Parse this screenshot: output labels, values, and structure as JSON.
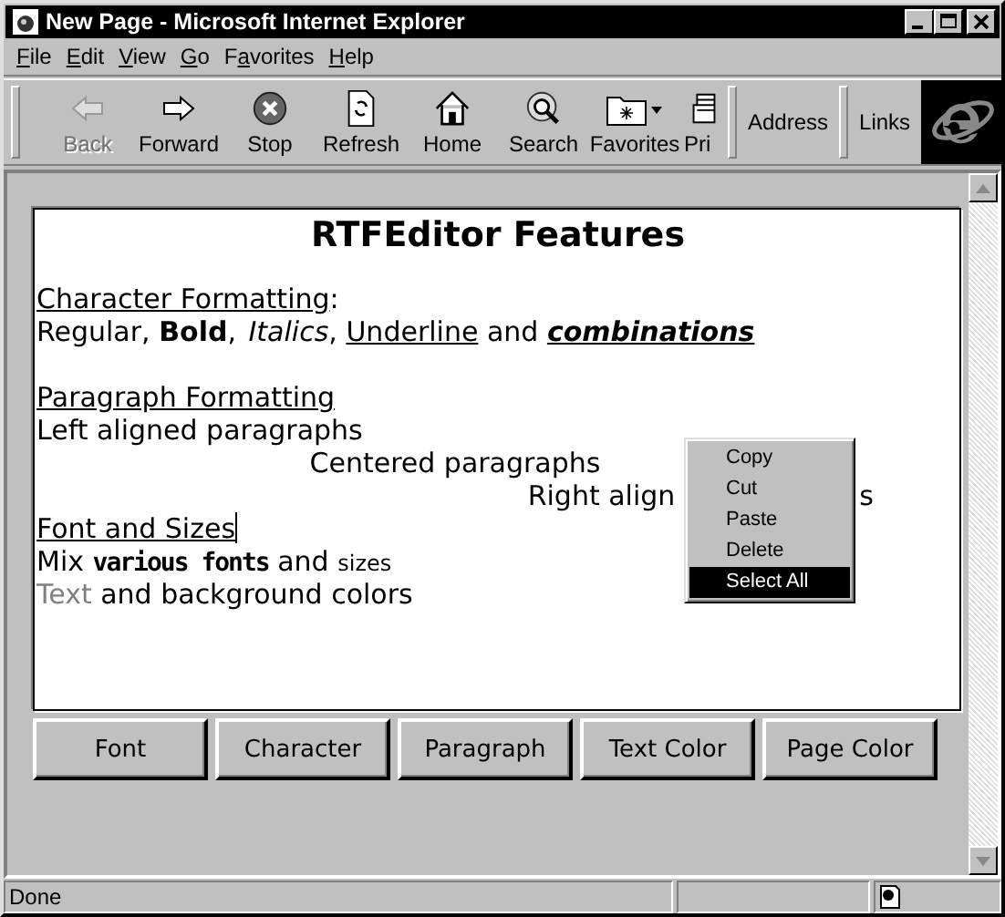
{
  "window": {
    "title": "New Page - Microsoft Internet Explorer",
    "controls": [
      {
        "kind": "minimize"
      },
      {
        "kind": "maximize"
      },
      {
        "kind": "close"
      }
    ]
  },
  "menu": [
    {
      "parts": [
        {
          "text": "F",
          "underlined": true
        },
        {
          "text": "ile",
          "underlined": false
        }
      ]
    },
    {
      "parts": [
        {
          "text": "E",
          "underlined": true
        },
        {
          "text": "dit",
          "underlined": false
        }
      ]
    },
    {
      "parts": [
        {
          "text": "V",
          "underlined": true
        },
        {
          "text": "iew",
          "underlined": false
        }
      ]
    },
    {
      "parts": [
        {
          "text": "G",
          "underlined": true
        },
        {
          "text": "o",
          "underlined": false
        }
      ]
    },
    {
      "parts": [
        {
          "text": "F",
          "underlined": false
        },
        {
          "text": "a",
          "underlined": true
        },
        {
          "text": "vorites",
          "underlined": false
        }
      ]
    },
    {
      "parts": [
        {
          "text": "H",
          "underlined": true
        },
        {
          "text": "elp",
          "underlined": false
        }
      ]
    }
  ],
  "toolbar": [
    {
      "kind": "back",
      "label": "Back",
      "disabled": true
    },
    {
      "kind": "forward",
      "label": "Forward",
      "disabled": false
    },
    {
      "kind": "stop",
      "label": "Stop",
      "disabled": false
    },
    {
      "kind": "refresh",
      "label": "Refresh",
      "disabled": false
    },
    {
      "kind": "home",
      "label": "Home",
      "disabled": false
    },
    {
      "kind": "search",
      "label": "Search",
      "disabled": false
    },
    {
      "kind": "favorites",
      "label": "Favorites",
      "disabled": false
    },
    {
      "kind": "print",
      "label": "Pri",
      "disabled": false
    }
  ],
  "address_label": "Address",
  "links_label": "Links",
  "editor": {
    "heading": "RTFEditor Features",
    "lines": [
      {
        "kind": "left",
        "segments": [
          {
            "text": "Character Formatting",
            "kind": "underline"
          },
          {
            "text": ":",
            "kind": "regular"
          }
        ]
      },
      {
        "kind": "left",
        "segments": [
          {
            "text": "Regular, ",
            "kind": "regular"
          },
          {
            "text": "Bold",
            "kind": "bold"
          },
          {
            "text": ", ",
            "kind": "regular"
          },
          {
            "text": "Italics",
            "kind": "italic"
          },
          {
            "text": ", ",
            "kind": "regular"
          },
          {
            "text": "Underline",
            "kind": "underline"
          },
          {
            "text": " and ",
            "kind": "regular"
          },
          {
            "text": "combinations",
            "kind": "combined"
          }
        ]
      },
      {
        "kind": "blank"
      },
      {
        "kind": "left",
        "segments": [
          {
            "text": "Paragraph Formatting",
            "kind": "underline"
          }
        ]
      },
      {
        "kind": "left",
        "segments": [
          {
            "text": "Left aligned paragraphs",
            "kind": "regular"
          }
        ]
      },
      {
        "kind": "center",
        "segments": [
          {
            "text": "Centered paragraphs",
            "kind": "regular"
          }
        ]
      },
      {
        "kind": "right",
        "covered": true,
        "segments": [
          {
            "text": "Right align",
            "kind": "regular"
          },
          {
            "text": "s",
            "kind": "regular"
          }
        ]
      },
      {
        "kind": "left",
        "caret": true,
        "segments": [
          {
            "text": "Font and Sizes",
            "kind": "underline"
          }
        ]
      },
      {
        "kind": "left",
        "segments": [
          {
            "text": "Mix ",
            "kind": "regular"
          },
          {
            "text": "various fonts",
            "kind": "display"
          },
          {
            "text": " and ",
            "kind": "regular"
          },
          {
            "text": "sizes",
            "kind": "small"
          }
        ]
      },
      {
        "kind": "left",
        "segments": [
          {
            "text": "Text",
            "kind": "colored",
            "color": "#808080"
          },
          {
            "text": " and background colors",
            "kind": "regular"
          }
        ]
      }
    ]
  },
  "context_menu": [
    {
      "label": "Copy",
      "selected": false
    },
    {
      "label": "Cut",
      "selected": false
    },
    {
      "label": "Paste",
      "selected": false
    },
    {
      "label": "Delete",
      "selected": false
    },
    {
      "label": "Select All",
      "selected": true
    }
  ],
  "buttons": [
    "Font",
    "Character",
    "Paragraph",
    "Text Color",
    "Page Color"
  ],
  "status_bar": {
    "text": "Done"
  }
}
